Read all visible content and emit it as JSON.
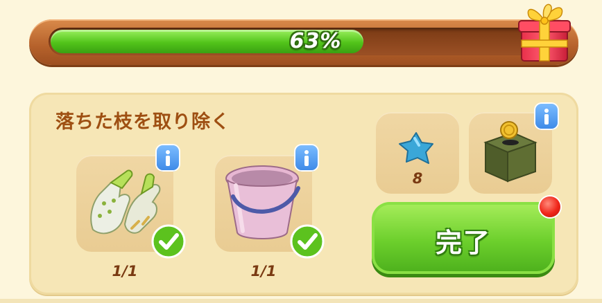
{
  "progress": {
    "percent_text": "63%",
    "fraction": 0.63
  },
  "task": {
    "title": "落ちた枝を取り除く",
    "items": [
      {
        "name": "gloves",
        "count": "1/1",
        "complete": true
      },
      {
        "name": "bucket",
        "count": "1/1",
        "complete": true
      }
    ],
    "rewards": [
      {
        "name": "blue-star",
        "count": "8"
      },
      {
        "name": "coin-box"
      }
    ],
    "complete_button_label": "完了"
  },
  "colors": {
    "progress_green": "#52c41a",
    "title_brown": "#9e4f12",
    "info_blue": "#3f8be8",
    "notify_red": "#f0261a"
  },
  "icons": [
    "gift-box-icon",
    "gloves-icon",
    "bucket-icon",
    "blue-star-icon",
    "coin-box-icon",
    "info-icon",
    "check-icon",
    "notification-dot-icon"
  ]
}
